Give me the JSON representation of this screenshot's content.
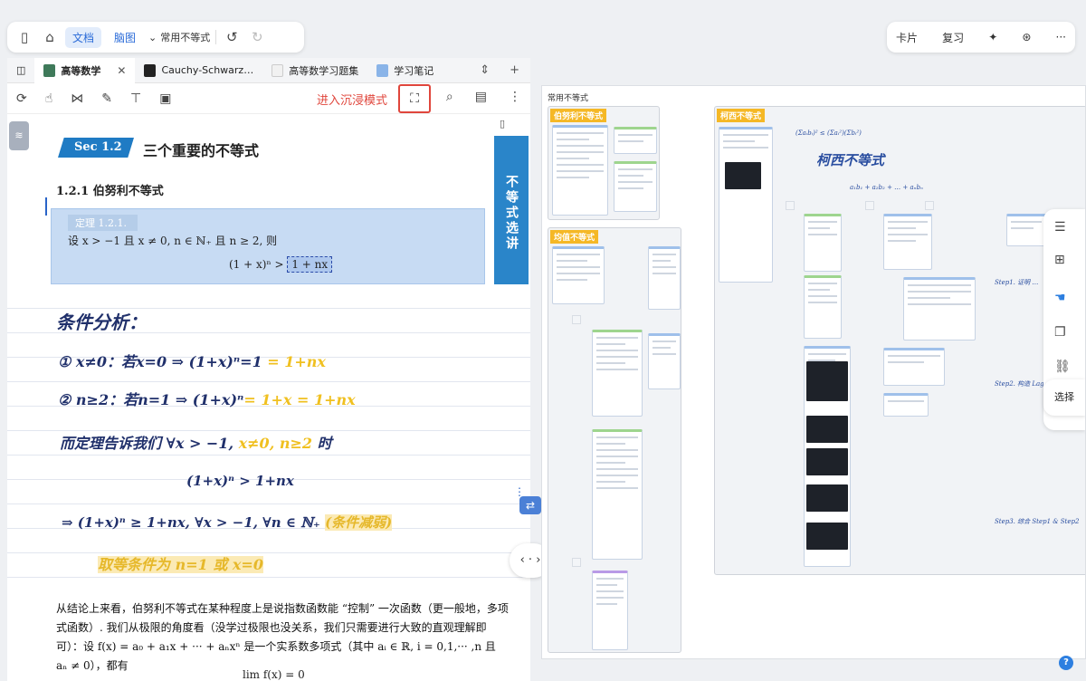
{
  "toolbar": {
    "mode_doc": "文档",
    "mode_mindmap": "脑图",
    "dropdown_label": "常用不等式"
  },
  "right_toolbar": {
    "cards": "卡片",
    "review": "复习"
  },
  "tabs": [
    {
      "label": "高等数学",
      "active": true
    },
    {
      "label": "Cauchy-Schwarz…"
    },
    {
      "label": "高等数学习题集"
    },
    {
      "label": "学习笔记"
    }
  ],
  "reader": {
    "immersive_label": "进入沉浸模式",
    "section_tag": "Sec 1.2",
    "section_title": "三个重要的不等式",
    "subsection": "1.2.1 伯努利不等式",
    "vertical_banner": "不等式选讲",
    "theorem_tag": "定理 1.2.1.",
    "theorem_line1": "设 x > −1 且 x ≠ 0, n ∈ ℕ₊ 且 n ≥ 2, 则",
    "theorem_lhs": "(1 + x)ⁿ >",
    "theorem_rhs": "1 + nx",
    "handnote": {
      "title": "条件分析：",
      "l1_main": "① x≠0：若x=0 ⇒ (1+x)ⁿ=1 ",
      "l1_tail": "= 1+nx",
      "l2_main": "② n≥2：若n=1 ⇒ (1+x)ⁿ",
      "l2_tail": "= 1+x = 1+nx",
      "l3_main": "而定理告诉我们 ∀x > −1, ",
      "l3_tail": "x≠0, n≥2",
      "l3_end": " 时",
      "l4": "(1+x)ⁿ > 1+nx",
      "l5_main": "⇒ (1+x)ⁿ ≥ 1+nx, ∀x > −1, ∀n ∈ ℕ₊ ",
      "l5_tail": "(条件减弱)",
      "l6": "取等条件为 n=1 或 x=0"
    },
    "paragraph": "从结论上来看，伯努利不等式在某种程度上是说指数函数能 “控制” 一次函数（更一般地，多项式函数）. 我们从极限的角度看（没学过极限也没关系，我们只需要进行大致的直观理解即可）：设 f(x) = a₀ + a₁x + ··· + aₙxⁿ 是一个实系数多项式（其中 aᵢ ∈ ℝ, i = 0,1,··· ,n 且 aₙ ≠ 0），都有",
    "limit": "lim f(x) = 0"
  },
  "mindmap": {
    "title": "常用不等式",
    "groups": [
      "伯努利不等式",
      "均值不等式",
      "柯西不等式"
    ],
    "handwritten_label": "柯西不等式",
    "select_label": "选择"
  },
  "colors": {
    "accent": "#2a6bd8",
    "highlight_red": "#e0463c",
    "group_orange": "#f5b826",
    "section_blue": "#1f7bc4"
  }
}
